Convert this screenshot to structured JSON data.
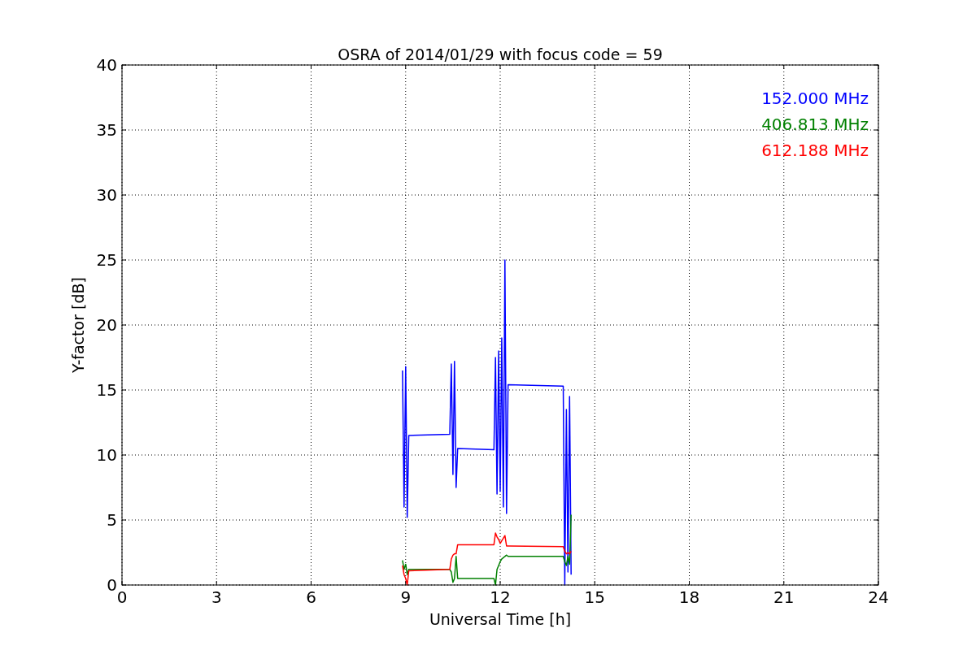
{
  "plot": {
    "chart_data": {
      "type": "line",
      "title": "OSRA of 2014/01/29 with focus code = 59",
      "xlabel": "Universal Time [h]",
      "ylabel": "Y-factor [dB]",
      "x": [
        8.9,
        8.95,
        9.0,
        9.05,
        9.1,
        10.4,
        10.45,
        10.5,
        10.55,
        10.6,
        10.65,
        11.8,
        11.85,
        11.9,
        11.95,
        12.0,
        12.05,
        12.1,
        12.15,
        12.2,
        12.25,
        14.0,
        14.05,
        14.1,
        14.15,
        14.2,
        14.25
      ],
      "series": [
        {
          "name": "152.000 MHz",
          "color": "#0000ff",
          "values": [
            16.5,
            6,
            16.8,
            5.2,
            11.5,
            11.6,
            17,
            8.5,
            17.2,
            7.5,
            10.5,
            10.4,
            17.5,
            7,
            18,
            7.2,
            19,
            6,
            25,
            5.5,
            15.4,
            15.3,
            0,
            13.5,
            1,
            14.5,
            0.8
          ]
        },
        {
          "name": "406.813 MHz",
          "color": "#008000",
          "values": [
            1.9,
            1.2,
            1.6,
            0.8,
            1.2,
            1.2,
            1.0,
            0.2,
            0.5,
            2.2,
            0.5,
            0.5,
            0,
            1.2,
            1.5,
            1.8,
            2.0,
            2.1,
            2.2,
            2.3,
            2.2,
            2.2,
            1.8,
            1.5,
            2.2,
            1.6,
            5.4
          ]
        },
        {
          "name": "612.188 MHz",
          "color": "#ff0000",
          "values": [
            1.5,
            0.8,
            0.5,
            0,
            1.1,
            1.2,
            2.0,
            2.3,
            2.4,
            2.4,
            3.1,
            3.1,
            4.0,
            3.7,
            3.5,
            3.2,
            3.4,
            3.6,
            3.8,
            3.0,
            3.0,
            2.95,
            2.6,
            2.4,
            2.5,
            2.4,
            2.6
          ]
        }
      ],
      "xlim": [
        0,
        24
      ],
      "ylim": [
        0,
        40
      ],
      "xticks": [
        0,
        3,
        6,
        9,
        12,
        15,
        18,
        21,
        24
      ],
      "yticks": [
        0,
        5,
        10,
        15,
        20,
        25,
        30,
        35,
        40
      ],
      "grid": true
    }
  }
}
